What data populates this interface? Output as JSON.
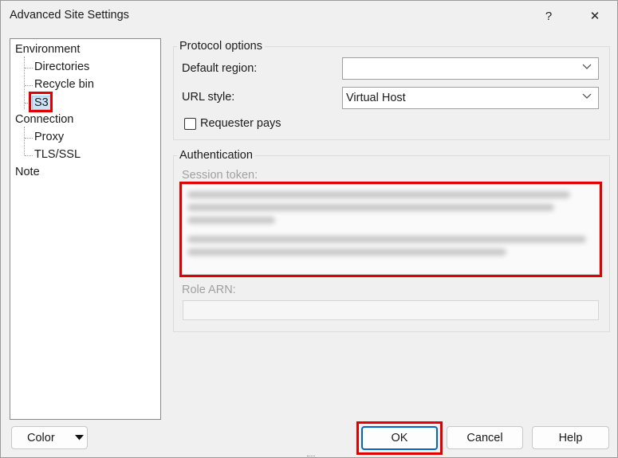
{
  "window": {
    "title": "Advanced Site Settings",
    "help_glyph": "?",
    "close_glyph": "✕"
  },
  "tree": {
    "environment": "Environment",
    "directories": "Directories",
    "recycle_bin": "Recycle bin",
    "s3": "S3",
    "connection": "Connection",
    "proxy": "Proxy",
    "tls_ssl": "TLS/SSL",
    "note": "Note",
    "selected": "S3"
  },
  "protocol": {
    "group_title": "Protocol options",
    "default_region_label": "Default region:",
    "default_region_value": "",
    "url_style_label": "URL style:",
    "url_style_value": "Virtual Host",
    "requester_pays_label": "Requester pays",
    "requester_pays_checked": false
  },
  "auth": {
    "group_title": "Authentication",
    "session_token_label": "Session token:",
    "role_arn_label": "Role ARN:",
    "role_arn_value": ""
  },
  "buttons": {
    "color": "Color",
    "ok": "OK",
    "cancel": "Cancel",
    "help": "Help"
  },
  "colors": {
    "highlight_red": "#e00000",
    "selection": "#cce4f7",
    "default_button_border": "#0067c0"
  }
}
